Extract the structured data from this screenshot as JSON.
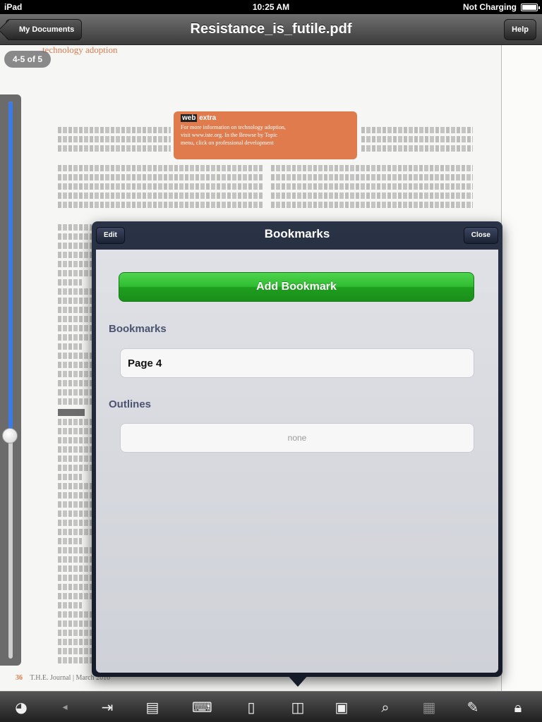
{
  "status_bar": {
    "device": "iPad",
    "time": "10:25 AM",
    "charging": "Not Charging"
  },
  "nav": {
    "title": "Resistance_is_futile.pdf",
    "back_label": "My Documents",
    "help_label": "Help"
  },
  "document": {
    "heading": "technology adoption",
    "page_indicator": "4-5 of 5",
    "sidebar": {
      "title_a": "web",
      "title_b": "extra",
      "lines": [
        "For more information on technology adoption,",
        "visit www.iste.org. In the Browse by Topic",
        "menu, click on professional development"
      ]
    },
    "footer_page": "36",
    "footer_text": "T.H.E. Journal | March 2010",
    "slider_position": 0.6
  },
  "bookmarks_popover": {
    "title": "Bookmarks",
    "edit_label": "Edit",
    "close_label": "Close",
    "add_button": "Add Bookmark",
    "bookmarks_header": "Bookmarks",
    "bookmarks": [
      "Page 4"
    ],
    "outlines_header": "Outlines",
    "outlines_empty": "none"
  },
  "toolbar": {
    "icons": [
      "rotate-icon",
      "previous-icon",
      "import-icon",
      "document-icon",
      "keyboard-icon",
      "single-page-icon",
      "bookmark-book-icon",
      "page-icon",
      "search-icon",
      "grid-icon",
      "annotate-icon",
      "lock-icon"
    ]
  }
}
